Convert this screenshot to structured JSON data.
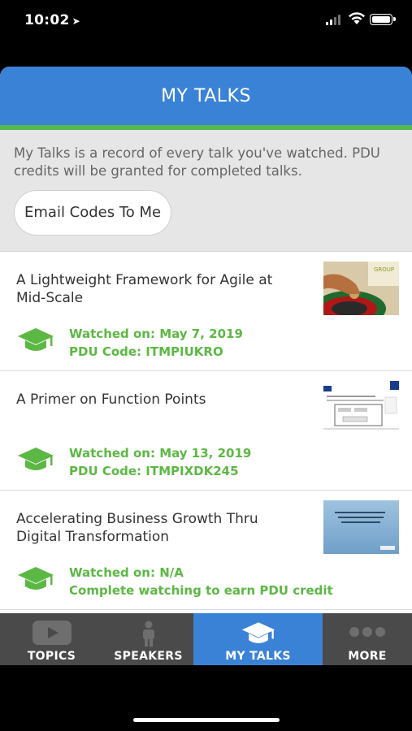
{
  "status_bar": {
    "time": "10:02"
  },
  "header": {
    "title": "MY TALKS"
  },
  "intro": {
    "description": "My Talks is a record of every talk you've watched. PDU credits will be granted for completed talks.",
    "email_button": "Email Codes To Me"
  },
  "talks": [
    {
      "title": "A Lightweight Framework for Agile at Mid-Scale",
      "watched": "Watched on: May 7, 2019",
      "pdu": "PDU Code: ITMPIUKRO"
    },
    {
      "title": "A Primer on Function Points",
      "watched": "Watched on: May 13, 2019",
      "pdu": "PDU Code: ITMPIXDK245"
    },
    {
      "title": "Accelerating Business Growth Thru Digital Transformation",
      "watched": "Watched on: N/A",
      "pdu": "Complete watching to earn PDU credit"
    }
  ],
  "tabs": [
    {
      "label": "TOPICS",
      "icon": "play-icon",
      "active": false
    },
    {
      "label": "SPEAKERS",
      "icon": "person-icon",
      "active": false
    },
    {
      "label": "MY TALKS",
      "icon": "graduation-cap-icon",
      "active": true
    },
    {
      "label": "MORE",
      "icon": "more-dots-icon",
      "active": false
    }
  ],
  "colors": {
    "header_blue": "#3a82d6",
    "accent_green": "#5cb844",
    "tabbar_gray": "#4a4a4a"
  }
}
